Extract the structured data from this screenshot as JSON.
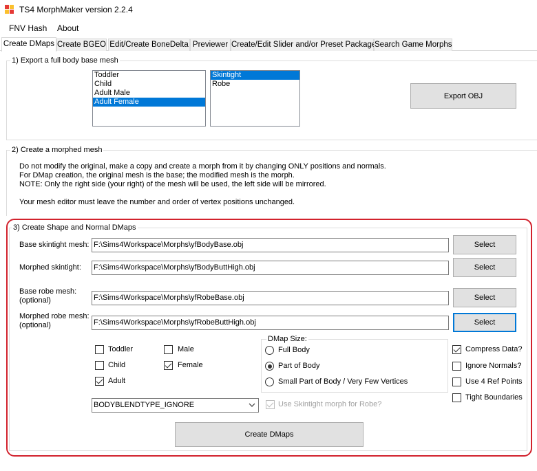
{
  "window": {
    "title": "TS4 MorphMaker version 2.2.4"
  },
  "menu": {
    "items": [
      "FNV Hash",
      "About"
    ]
  },
  "tabs": [
    "Create DMaps",
    "Create BGEO",
    "Edit/Create BoneDelta",
    "Previewer",
    "Create/Edit Slider and/or Preset Package",
    "Search Game Morphs"
  ],
  "section1": {
    "title": "1) Export a full body base mesh",
    "ages": [
      "Toddler",
      "Child",
      "Adult Male",
      "Adult Female"
    ],
    "selected_age": "Adult Female",
    "meshes": [
      "Skintight",
      "Robe"
    ],
    "selected_mesh": "Skintight",
    "export_button": "Export OBJ"
  },
  "section2": {
    "title": "2) Create a morphed mesh",
    "lines": [
      "Do not modify the original, make a copy and create a morph from it by changing ONLY positions and normals.",
      "For DMap creation, the original mesh is the base; the modified mesh is the morph.",
      "NOTE: Only the right side (your right) of the mesh will be used, the left side will be mirrored.",
      "Your mesh editor must leave the number and order of vertex positions unchanged."
    ]
  },
  "section3": {
    "title": "3) Create Shape and Normal DMaps",
    "base_skintight_label": "Base skintight mesh:",
    "base_skintight_value": "F:\\Sims4Workspace\\Morphs\\yfBodyBase.obj",
    "morphed_skintight_label": "Morphed skintight:",
    "morphed_skintight_value": "F:\\Sims4Workspace\\Morphs\\yfBodyButtHigh.obj",
    "base_robe_label": "Base robe mesh:",
    "base_robe_optional": "(optional)",
    "base_robe_value": "F:\\Sims4Workspace\\Morphs\\yfRobeBase.obj",
    "morphed_robe_label": "Morphed robe mesh:",
    "morphed_robe_optional": "(optional)",
    "morphed_robe_value": "F:\\Sims4Workspace\\Morphs\\yfRobeButtHigh.obj",
    "select_label": "Select",
    "checks": {
      "toddler": "Toddler",
      "child": "Child",
      "adult": "Adult",
      "male": "Male",
      "female": "Female"
    },
    "dmap_size": {
      "title": "DMap Size:",
      "options": [
        "Full Body",
        "Part of Body",
        "Small Part of Body / Very Few Vertices"
      ],
      "selected": "Part of Body"
    },
    "options": {
      "compress": "Compress Data?",
      "ignore_normals": "Ignore Normals?",
      "ref_points": "Use 4 Ref Points",
      "tight": "Tight Boundaries"
    },
    "blend_type": "BODYBLENDTYPE_IGNORE",
    "use_skintight_label": "Use Skintight morph for Robe?",
    "create_button": "Create DMaps"
  },
  "colors": {
    "selection": "#0078d7",
    "highlight": "#d2222d"
  }
}
